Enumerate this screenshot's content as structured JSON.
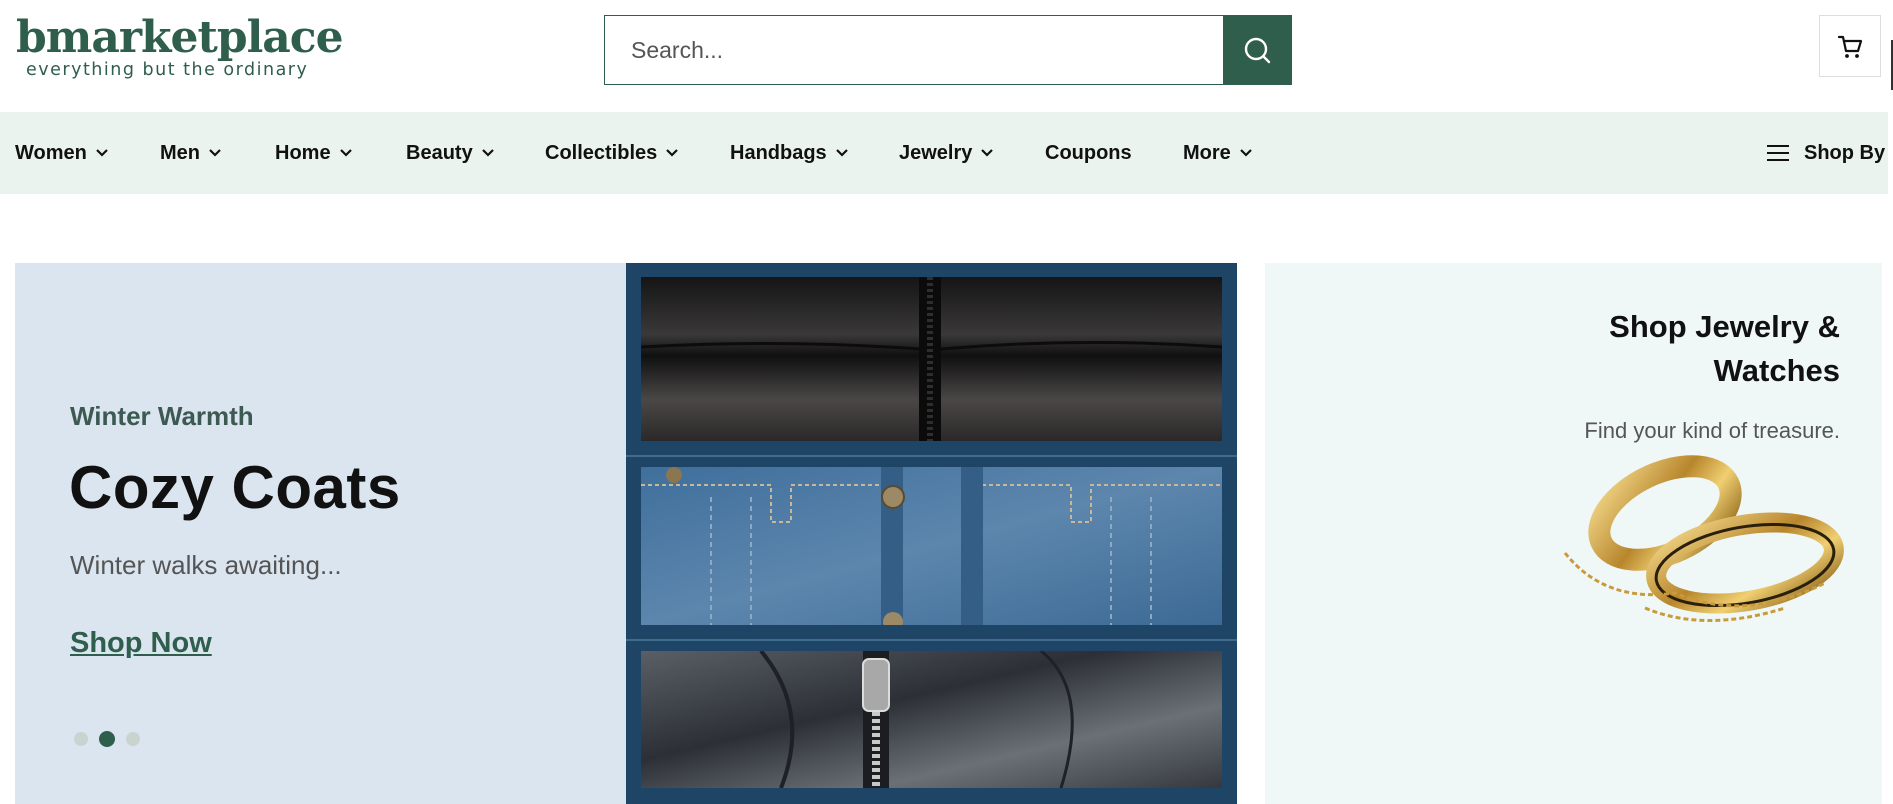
{
  "brand": {
    "logo_word": "bmarketplace",
    "tagline": "everything but the ordinary",
    "color": "#2f5e4d"
  },
  "search": {
    "placeholder": "Search...",
    "button_icon": "search-icon"
  },
  "cart": {
    "icon": "cart-icon"
  },
  "nav": {
    "items": [
      {
        "label": "Women",
        "has_dropdown": true
      },
      {
        "label": "Men",
        "has_dropdown": true
      },
      {
        "label": "Home",
        "has_dropdown": true
      },
      {
        "label": "Beauty",
        "has_dropdown": true
      },
      {
        "label": "Collectibles",
        "has_dropdown": true
      },
      {
        "label": "Handbags",
        "has_dropdown": true
      },
      {
        "label": "Jewelry",
        "has_dropdown": true
      },
      {
        "label": "Coupons",
        "has_dropdown": false
      },
      {
        "label": "More",
        "has_dropdown": true
      }
    ],
    "shop_by": "Shop By",
    "background": "#ebf3ef"
  },
  "hero": {
    "eyebrow": "Winter Warmth",
    "title": "Cozy Coats",
    "subtitle": "Winter walks awaiting...",
    "cta": "Shop Now",
    "background": "#dae5f0",
    "carousel": {
      "total": 3,
      "active": 2
    }
  },
  "promo": {
    "title": "Shop Jewelry & Watches",
    "subtitle": "Find your kind of treasure.",
    "background": "#eff8f6"
  }
}
